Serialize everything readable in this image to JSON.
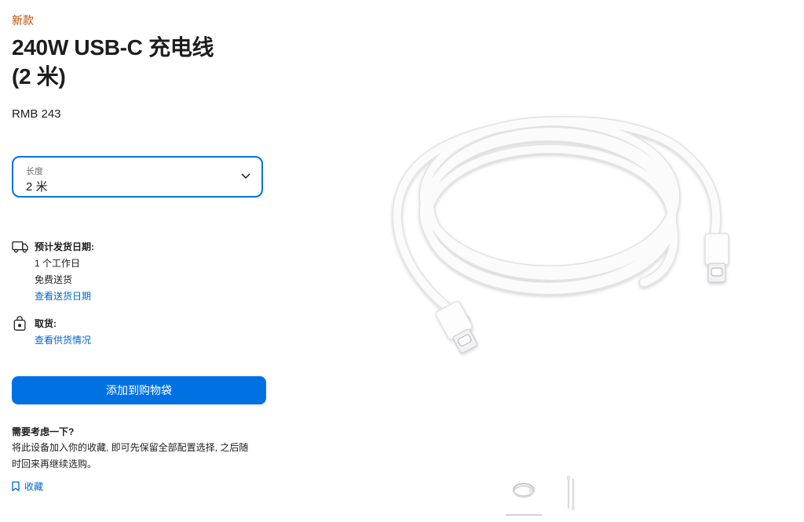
{
  "product": {
    "badge": "新款",
    "title_line1": "240W USB-C 充电线",
    "title_line2": "(2 米)",
    "price": "RMB 243"
  },
  "length_select": {
    "label": "长度",
    "value": "2 米",
    "icon": "chevron-down-icon"
  },
  "delivery": {
    "icon": "truck-icon",
    "heading": "预计发货日期:",
    "line1": "1 个工作日",
    "line2": "免费送货",
    "link": "查看送货日期"
  },
  "pickup": {
    "icon": "apple-bag-icon",
    "heading": "取货:",
    "link": "查看供货情况"
  },
  "add_to_bag": "添加到购物袋",
  "consider": {
    "heading": "需要考虑一下?",
    "text": "将此设备加入你的收藏, 即可先保留全部配置选择, 之后随时回来再继续选购。",
    "save_link": "收藏",
    "save_icon": "bookmark-icon"
  },
  "gallery": {
    "thumbnails": [
      "coiled-cable-thumbnail",
      "straight-cable-thumbnail"
    ],
    "selected_index": 0
  },
  "colors": {
    "accent": "#0071e3",
    "link": "#0066cc",
    "badge": "#bf4800"
  }
}
